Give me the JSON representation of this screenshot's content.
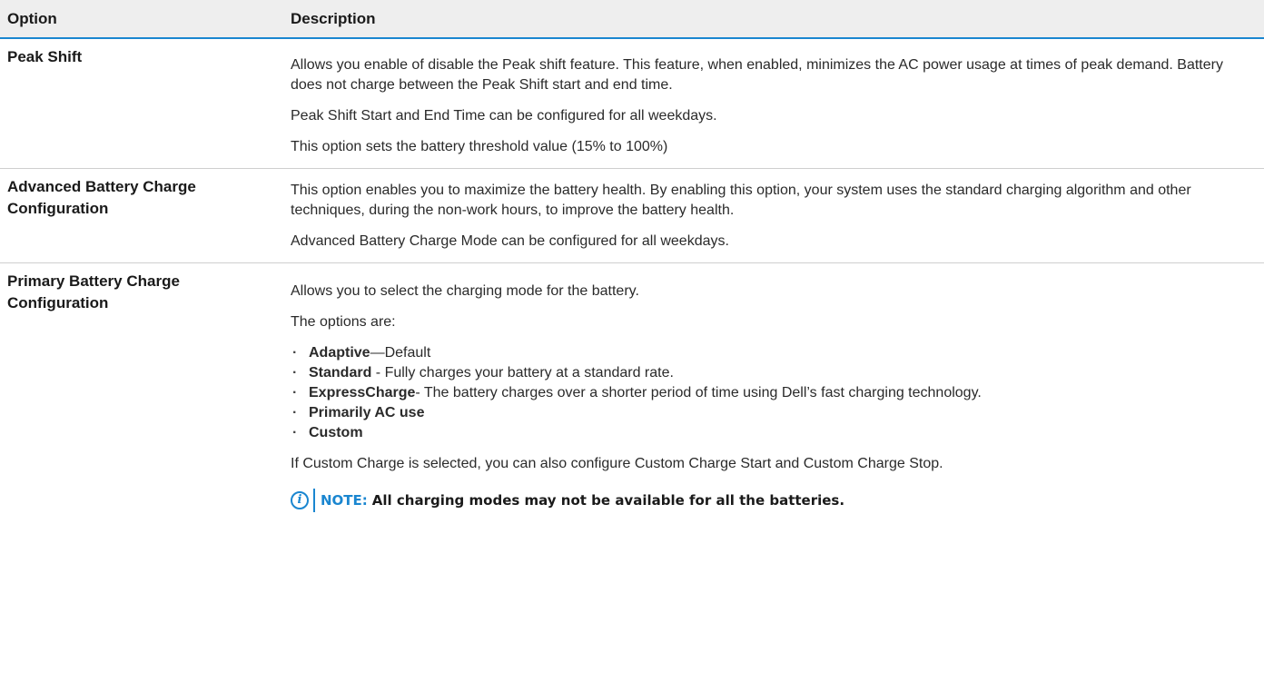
{
  "header": {
    "option": "Option",
    "description": "Description"
  },
  "rows": [
    {
      "option": "Peak Shift",
      "paragraphs": [
        "Allows you enable of disable the Peak shift feature. This feature, when enabled, minimizes the AC power usage at times of peak demand. Battery does not charge between the Peak Shift start and end time.",
        "Peak Shift Start and End Time can be configured for all weekdays.",
        "This option sets the battery threshold value (15% to 100%)"
      ]
    },
    {
      "option": "Advanced Battery Charge Configuration",
      "paragraphs": [
        "This option enables you to maximize the battery health. By enabling this option, your system uses the standard charging algorithm and other techniques, during the non-work hours, to improve the battery health.",
        "Advanced Battery Charge Mode can be configured for all weekdays."
      ]
    },
    {
      "option": "Primary Battery Charge Configuration",
      "intro": "Allows you to select the charging mode for the battery.",
      "options_label": "The options are:",
      "items": [
        {
          "name": "Adaptive",
          "desc": "—Default"
        },
        {
          "name": "Standard",
          "desc": " - Fully charges your battery at a standard rate."
        },
        {
          "name": "ExpressCharge",
          "desc": "- The battery charges over a shorter period of time using Dell’s fast charging technology."
        },
        {
          "name": "Primarily AC use",
          "desc": ""
        },
        {
          "name": "Custom",
          "desc": ""
        }
      ],
      "custom_note": "If Custom Charge is selected, you can also configure Custom Charge Start and Custom Charge Stop.",
      "note": {
        "icon": "info-icon",
        "label": "NOTE:",
        "text": "All charging modes may not be available for all the batteries."
      }
    }
  ],
  "colors": {
    "accent": "#1a86d0",
    "header_bg": "#eeeeee"
  }
}
